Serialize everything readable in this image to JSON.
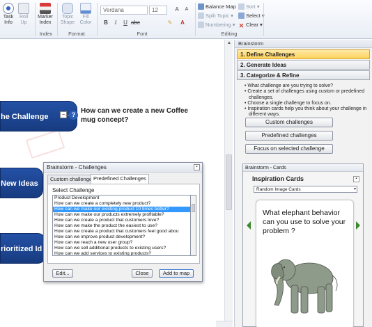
{
  "ribbon": {
    "task_info": "Task\nInfo",
    "roll_up": "Roll\nUp",
    "marker_index": "Marker\nIndex",
    "topic_shape": "Topic\nShape",
    "fill_color": "Fill\nColor",
    "font_name": "Verdana",
    "font_size": "12",
    "groups": {
      "index": "Index",
      "format": "Format",
      "font": "Font",
      "editing": "Editing"
    },
    "balance_map": "Balance Map",
    "split_topic": "Split Topic",
    "numbering": "Numbering",
    "sort": "Sort",
    "select": "Select",
    "clear": "Clear"
  },
  "map": {
    "central_topic": "he Challenge",
    "subtopic": "How can we create a new Coffee\nmug concept?",
    "topic_new_ideas": "New Ideas",
    "topic_prioritized": "rioritized Id"
  },
  "dialog": {
    "title": "Brainstorm - Challenges",
    "tabs": [
      "Custom challenges",
      "Predefined Challenges"
    ],
    "select_label": "Select Challenge",
    "items": [
      "Product Development",
      "How can we create a completely new product?",
      "How can we make our existing product 10 times better?",
      "How can we make our products extremely profitable?",
      "How can we create a product that customers love?",
      "How can we make the product the easiest to use?",
      "How can we create a product that customers feel good abou",
      "How can we improve product development?",
      "How can we reach a new user group?",
      "How can we sell additional products to existing users?",
      "How can we add services to existing products?"
    ],
    "selected_index": 2,
    "edit_button": "Edit...",
    "close_button": "Close",
    "add_button": "Add to map"
  },
  "pane": {
    "title": "Brainstorm",
    "steps": [
      "1. Define Challenges",
      "2. Generate Ideas",
      "3. Categorize & Refine"
    ],
    "bullets": [
      "• What challenge are you trying to solve?",
      "• Create a set of challenges using custom or predefined challenges.",
      "• Choose a single challenge to focus on.",
      "• Inspiration cards help you think about your challenge in different ways."
    ],
    "custom_btn": "Custom challenges",
    "predefined_btn": "Predefined challenges",
    "focus_btn": "Focus on selected challenge",
    "cards_title": "Brainstorm - Cards",
    "inspiration_heading": "Inspiration Cards",
    "card_source": "Random Image Cards",
    "card_question": "What elephant  behavior can you use to solve your problem  ?"
  },
  "colors": {
    "topic_blue": "#1f4795",
    "active_step": "#ffd35c",
    "nav_green": "#3b8a2d",
    "selection": "#3399ff"
  }
}
